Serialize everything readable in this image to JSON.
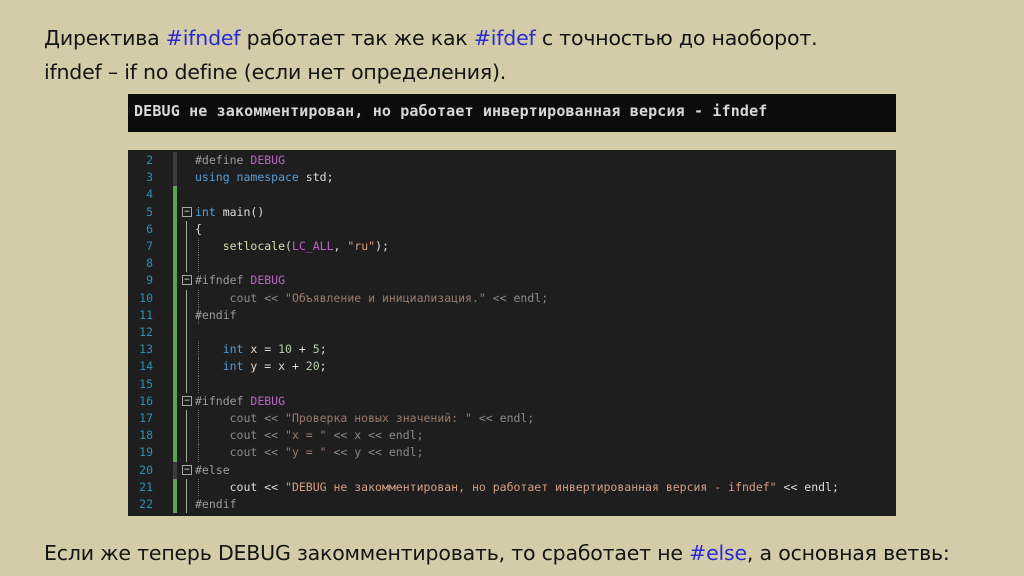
{
  "intro": {
    "line1": {
      "before": "Директива ",
      "hl1": "#ifndef",
      "middle": " работает так же как ",
      "hl2": "#ifdef",
      "after": " с точностью до наоборот."
    },
    "line2": "ifndef – if no define (если нет определения)."
  },
  "console": {
    "output": "DEBUG не закомментирован, но работает инвертированная версия - ifndef"
  },
  "code_lines": [
    {
      "n": "2",
      "segs": [
        {
          "t": "#define ",
          "c": "pp"
        },
        {
          "t": "DEBUG",
          "c": "mac"
        }
      ]
    },
    {
      "n": "3",
      "segs": [
        {
          "t": "using ",
          "c": "kw"
        },
        {
          "t": "namespace ",
          "c": "kw"
        },
        {
          "t": "std;",
          "c": ""
        }
      ]
    },
    {
      "n": "4",
      "segs": []
    },
    {
      "n": "5",
      "segs": [
        {
          "t": "int ",
          "c": "kw"
        },
        {
          "t": "main()",
          "c": ""
        }
      ]
    },
    {
      "n": "6",
      "segs": [
        {
          "t": "{",
          "c": ""
        }
      ]
    },
    {
      "n": "7",
      "segs": [
        {
          "t": "    ",
          "c": ""
        },
        {
          "t": "setlocale",
          "c": "fn"
        },
        {
          "t": "(",
          "c": ""
        },
        {
          "t": "LC_ALL",
          "c": "mac"
        },
        {
          "t": ", ",
          "c": ""
        },
        {
          "t": "\"ru\"",
          "c": "str"
        },
        {
          "t": ");",
          "c": ""
        }
      ]
    },
    {
      "n": "8",
      "segs": []
    },
    {
      "n": "9",
      "segs": [
        {
          "t": "#ifndef ",
          "c": "pp"
        },
        {
          "t": "DEBUG",
          "c": "mac"
        }
      ]
    },
    {
      "n": "10",
      "segs": [
        {
          "t": "     cout << ",
          "c": "dim"
        },
        {
          "t": "\"Объявление и инициализация.\"",
          "c": "dimstr"
        },
        {
          "t": " << endl;",
          "c": "dim"
        }
      ]
    },
    {
      "n": "11",
      "segs": [
        {
          "t": "#endif",
          "c": "pp"
        }
      ]
    },
    {
      "n": "12",
      "segs": []
    },
    {
      "n": "13",
      "segs": [
        {
          "t": "    ",
          "c": ""
        },
        {
          "t": "int ",
          "c": "kw"
        },
        {
          "t": "x = ",
          "c": ""
        },
        {
          "t": "10",
          "c": "num"
        },
        {
          "t": " + ",
          "c": ""
        },
        {
          "t": "5",
          "c": "num"
        },
        {
          "t": ";",
          "c": ""
        }
      ]
    },
    {
      "n": "14",
      "segs": [
        {
          "t": "    ",
          "c": ""
        },
        {
          "t": "int ",
          "c": "kw"
        },
        {
          "t": "y = x + ",
          "c": ""
        },
        {
          "t": "20",
          "c": "num"
        },
        {
          "t": ";",
          "c": ""
        }
      ]
    },
    {
      "n": "15",
      "segs": []
    },
    {
      "n": "16",
      "segs": [
        {
          "t": "#ifndef ",
          "c": "pp"
        },
        {
          "t": "DEBUG",
          "c": "mac"
        }
      ]
    },
    {
      "n": "17",
      "segs": [
        {
          "t": "     cout << ",
          "c": "dim"
        },
        {
          "t": "\"Проверка новых значений: \"",
          "c": "dimstr"
        },
        {
          "t": " << endl;",
          "c": "dim"
        }
      ]
    },
    {
      "n": "18",
      "segs": [
        {
          "t": "     cout << ",
          "c": "dim"
        },
        {
          "t": "\"x = \"",
          "c": "dimstr"
        },
        {
          "t": " << x << endl;",
          "c": "dim"
        }
      ]
    },
    {
      "n": "19",
      "segs": [
        {
          "t": "     cout << ",
          "c": "dim"
        },
        {
          "t": "\"y = \"",
          "c": "dimstr"
        },
        {
          "t": " << y << endl;",
          "c": "dim"
        }
      ]
    },
    {
      "n": "20",
      "segs": [
        {
          "t": "#else",
          "c": "pp"
        }
      ]
    },
    {
      "n": "21",
      "segs": [
        {
          "t": "     cout << ",
          "c": ""
        },
        {
          "t": "\"DEBUG не закомментирован, но работает инвертированная версия - ifndef\"",
          "c": "str"
        },
        {
          "t": " << endl;",
          "c": ""
        }
      ]
    },
    {
      "n": "22",
      "segs": [
        {
          "t": "#endif",
          "c": "pp"
        }
      ]
    }
  ],
  "bottom": {
    "before": "Если же теперь DEBUG закомментировать, то сработает не ",
    "hl": "#else",
    "after": ", а основная ветвь:"
  },
  "colors": {
    "background": "#d4cca8",
    "highlight": "#2a2ad0",
    "editor_bg": "#1e1e1e",
    "console_bg": "#0c0c0c"
  }
}
